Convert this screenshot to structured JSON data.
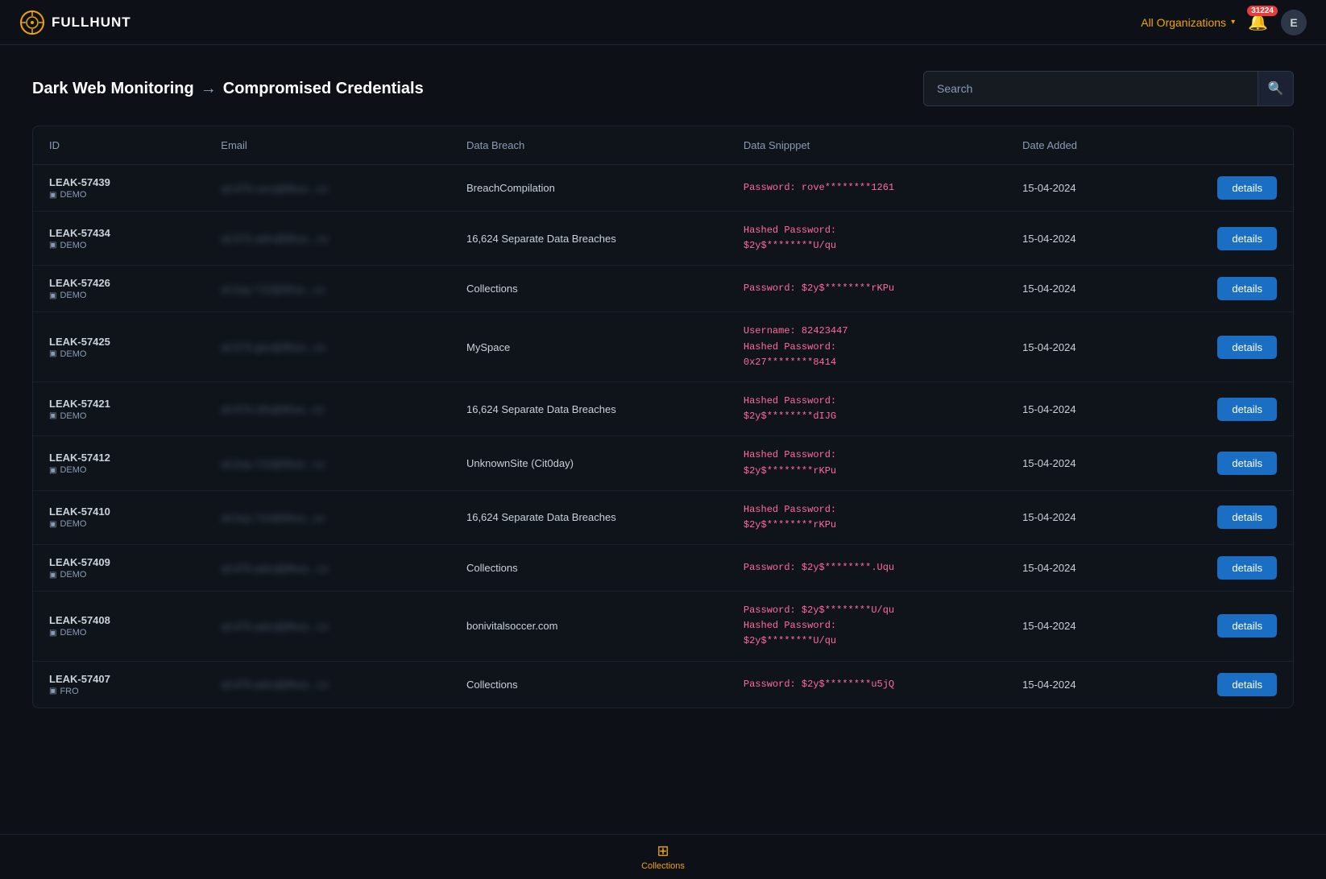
{
  "app": {
    "name": "FULLHUNT",
    "logo_symbol": "🎯"
  },
  "nav": {
    "org_selector": "All Organizations",
    "notifications_count": "31224",
    "user_initial": "E"
  },
  "page": {
    "title": "Dark Web Monitoring",
    "separator": "→",
    "subtitle": "Compromised Credentials",
    "search_placeholder": "Search"
  },
  "table": {
    "columns": [
      "ID",
      "Email",
      "Data Breach",
      "Data Snipppet",
      "Date Added",
      ""
    ],
    "rows": [
      {
        "id": "LEAK-57439",
        "tag": "DEMO",
        "email": "ali.876.cem@8hos...co",
        "breach": "BreachCompilation",
        "snippet": [
          "Password: rove********1261"
        ],
        "date": "15-04-2024"
      },
      {
        "id": "LEAK-57434",
        "tag": "DEMO",
        "email": "ali.876.adm@8hos...co",
        "breach": "16,624 Separate Data Breaches",
        "snippet": [
          "Hashed Password:",
          "$2y$********U/qu"
        ],
        "date": "15-04-2024"
      },
      {
        "id": "LEAK-57426",
        "tag": "DEMO",
        "email": "ali.bsp.710@8hos...co",
        "breach": "Collections",
        "snippet": [
          "Password: $2y$********rKPu"
        ],
        "date": "15-04-2024"
      },
      {
        "id": "LEAK-57425",
        "tag": "DEMO",
        "email": "ali.876.gen@8hos...co",
        "breach": "MySpace",
        "snippet": [
          "Username: 82423447",
          "Hashed Password:",
          "0x27********8414"
        ],
        "date": "15-04-2024"
      },
      {
        "id": "LEAK-57421",
        "tag": "DEMO",
        "email": "ali.876.c8s@8hos...co",
        "breach": "16,624 Separate Data Breaches",
        "snippet": [
          "Hashed Password:",
          "$2y$********dIJG"
        ],
        "date": "15-04-2024"
      },
      {
        "id": "LEAK-57412",
        "tag": "DEMO",
        "email": "ali.bsp.710@8hos...co",
        "breach": "UnknownSite (Cit0day)",
        "snippet": [
          "Hashed Password:",
          "$2y$********rKPu"
        ],
        "date": "15-04-2024"
      },
      {
        "id": "LEAK-57410",
        "tag": "DEMO",
        "email": "ali.bsp.710@8hos...co",
        "breach": "16,624 Separate Data Breaches",
        "snippet": [
          "Hashed Password:",
          "$2y$********rKPu"
        ],
        "date": "15-04-2024"
      },
      {
        "id": "LEAK-57409",
        "tag": "DEMO",
        "email": "ali.876.adm@8hos...co",
        "breach": "Collections",
        "snippet": [
          "Password: $2y$********.Uqu"
        ],
        "date": "15-04-2024"
      },
      {
        "id": "LEAK-57408",
        "tag": "DEMO",
        "email": "ali.876.adm@8hos...co",
        "breach": "bonivitalsoccer.com",
        "snippet": [
          "Password: $2y$********U/qu",
          "Hashed Password:",
          "$2y$********U/qu"
        ],
        "date": "15-04-2024"
      },
      {
        "id": "LEAK-57407",
        "tag": "FRO",
        "email": "ali.876.adm@8hos...co",
        "breach": "Collections",
        "snippet": [
          "Password: $2y$********u5jQ"
        ],
        "date": "15-04-2024"
      }
    ],
    "details_label": "details"
  },
  "bottom_nav": {
    "items": [
      {
        "label": "Collections",
        "icon": "⊞",
        "active": true
      }
    ]
  }
}
